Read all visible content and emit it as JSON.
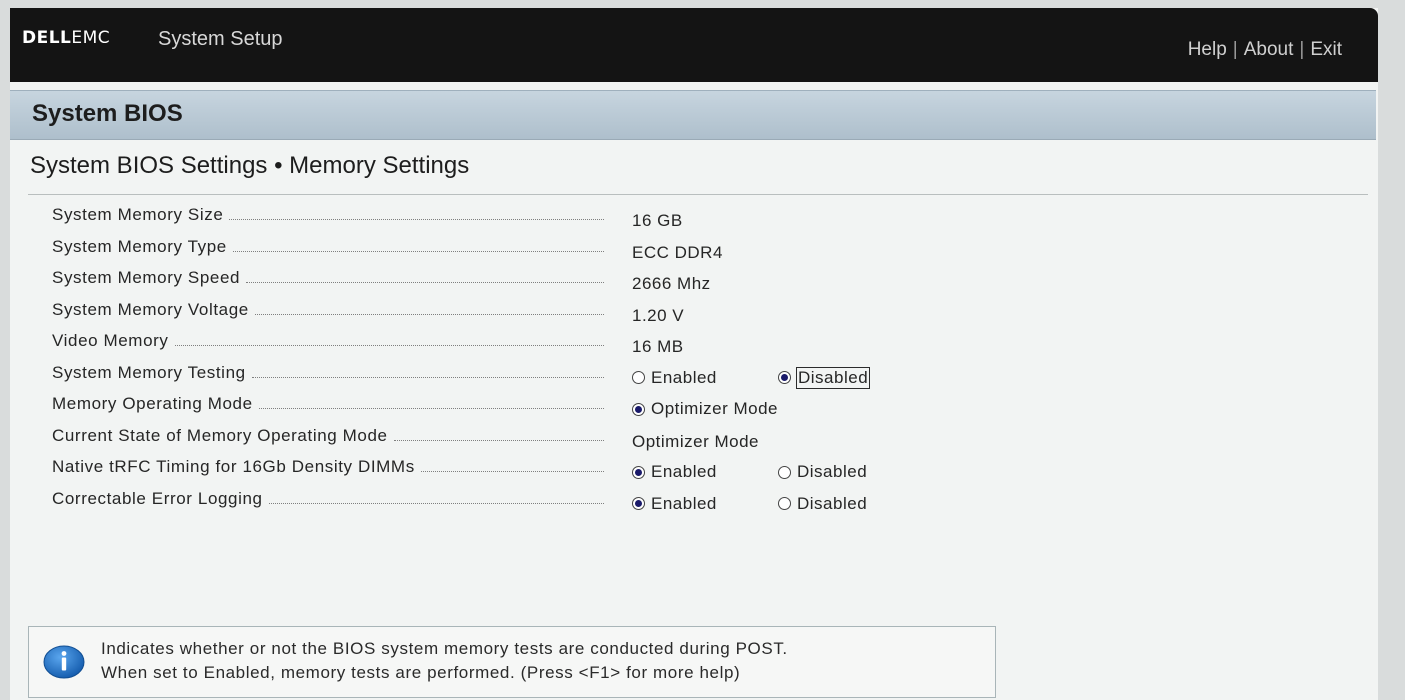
{
  "header": {
    "logo_brand": "DELL",
    "logo_suffix": "EMC",
    "app_title": "System Setup",
    "nav": [
      "Help",
      "About",
      "Exit"
    ],
    "nav_separator": "|"
  },
  "section": {
    "title": "System BIOS"
  },
  "page": {
    "title": "System BIOS Settings • Memory Settings"
  },
  "settings": [
    {
      "label": "System Memory Size",
      "value": "16 GB"
    },
    {
      "label": "System Memory Type",
      "value": "ECC DDR4"
    },
    {
      "label": "System Memory Speed",
      "value": "2666 Mhz"
    },
    {
      "label": "System Memory Voltage",
      "value": "1.20 V"
    },
    {
      "label": "Video Memory",
      "value": "16 MB"
    },
    {
      "label": "System Memory Testing",
      "options": [
        "Enabled",
        "Disabled"
      ],
      "selected": "Disabled"
    },
    {
      "label": "Memory Operating Mode",
      "options": [
        "Optimizer Mode"
      ],
      "selected": "Optimizer Mode"
    },
    {
      "label": "Current State of Memory Operating Mode",
      "value": "Optimizer Mode"
    },
    {
      "label": "Native tRFC Timing for 16Gb Density DIMMs",
      "options": [
        "Enabled",
        "Disabled"
      ],
      "selected": "Enabled"
    },
    {
      "label": "Correctable Error Logging",
      "options": [
        "Enabled",
        "Disabled"
      ],
      "selected": "Enabled"
    }
  ],
  "help": {
    "line1": "Indicates whether or not the BIOS system memory tests are conducted during POST.",
    "line2": "When set to Enabled, memory tests are performed. (Press <F1> for more help)",
    "icon": "info-icon"
  },
  "colors": {
    "topbar": "#141414",
    "section_header": "#b9c9d5",
    "info_icon": "#1f6fc4"
  }
}
